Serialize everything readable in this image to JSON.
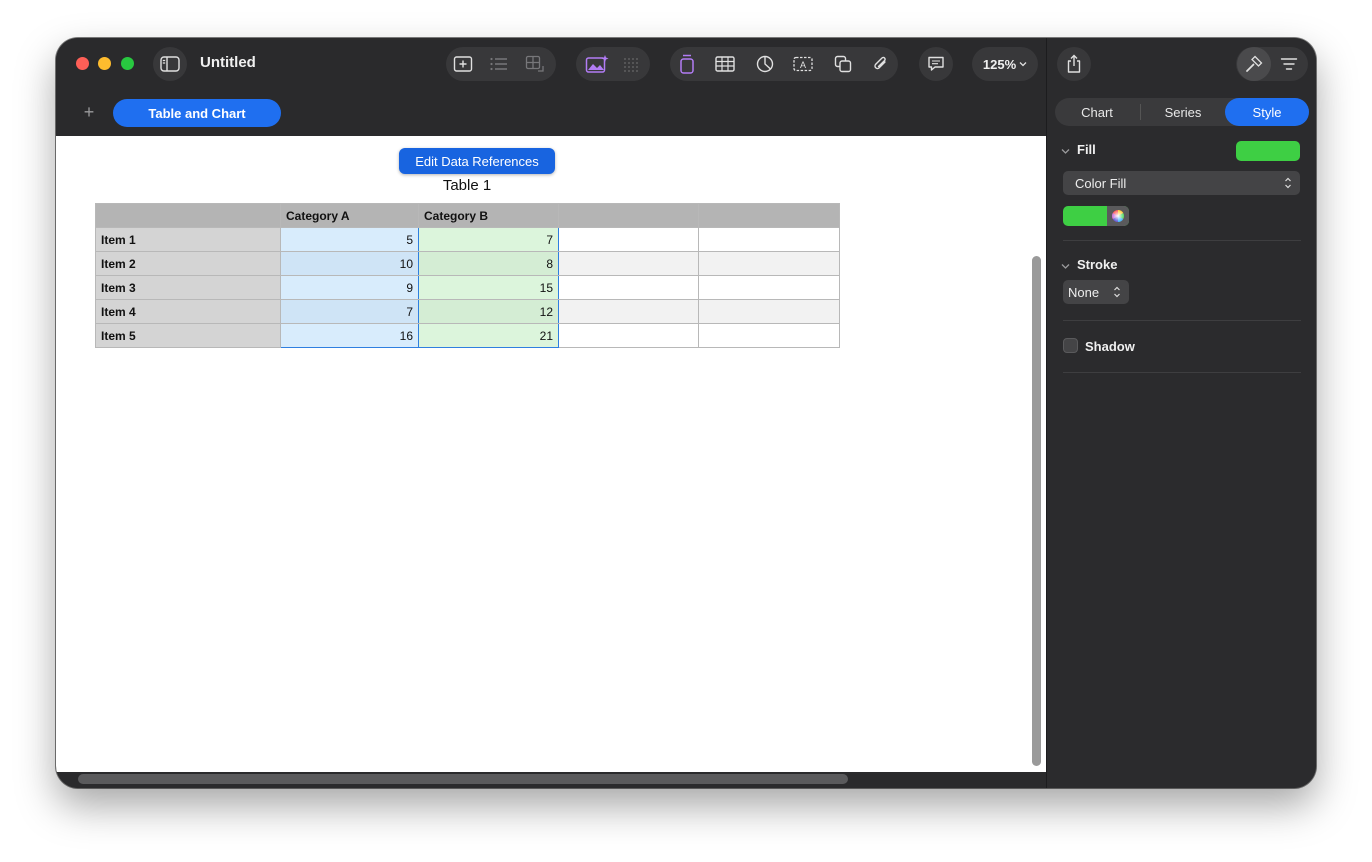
{
  "window": {
    "title": "Untitled",
    "zoom": "125%",
    "sheet_tab": "Table and Chart",
    "add_sheet": "+"
  },
  "canvas": {
    "edit_refs_label": "Edit Data References",
    "table_title": "Table 1",
    "table": {
      "headers": [
        "",
        "Category A",
        "Category B",
        "",
        ""
      ],
      "rows": [
        {
          "label": "Item 1",
          "a": "5",
          "b": "7"
        },
        {
          "label": "Item 2",
          "a": "10",
          "b": "8"
        },
        {
          "label": "Item 3",
          "a": "9",
          "b": "15"
        },
        {
          "label": "Item 4",
          "a": "7",
          "b": "12"
        },
        {
          "label": "Item 5",
          "a": "16",
          "b": "21"
        }
      ]
    }
  },
  "inspector": {
    "tabs": [
      "Chart",
      "Series",
      "Style"
    ],
    "active_tab": "Style",
    "fill": {
      "label": "Fill",
      "type": "Color Fill",
      "color": "#3ecf44"
    },
    "stroke": {
      "label": "Stroke",
      "value": "None"
    },
    "shadow": {
      "label": "Shadow",
      "checked": false
    }
  },
  "icons": {
    "sidebar": "sidebar-icon",
    "insert": [
      "add-page-icon",
      "list-icon",
      "table-cell-icon",
      "media-icon",
      "grid-icon",
      "text-box-icon",
      "table-icon",
      "chart-icon",
      "text-icon",
      "shape-icon",
      "attachment-icon",
      "comment-icon",
      "share-icon",
      "format-icon",
      "organize-icon"
    ]
  },
  "colors": {
    "accent": "#1f6ff0",
    "fill_green": "#3ecf44",
    "category_a_cell": "#d8ecfc",
    "category_b_cell": "#dcf5dc"
  }
}
